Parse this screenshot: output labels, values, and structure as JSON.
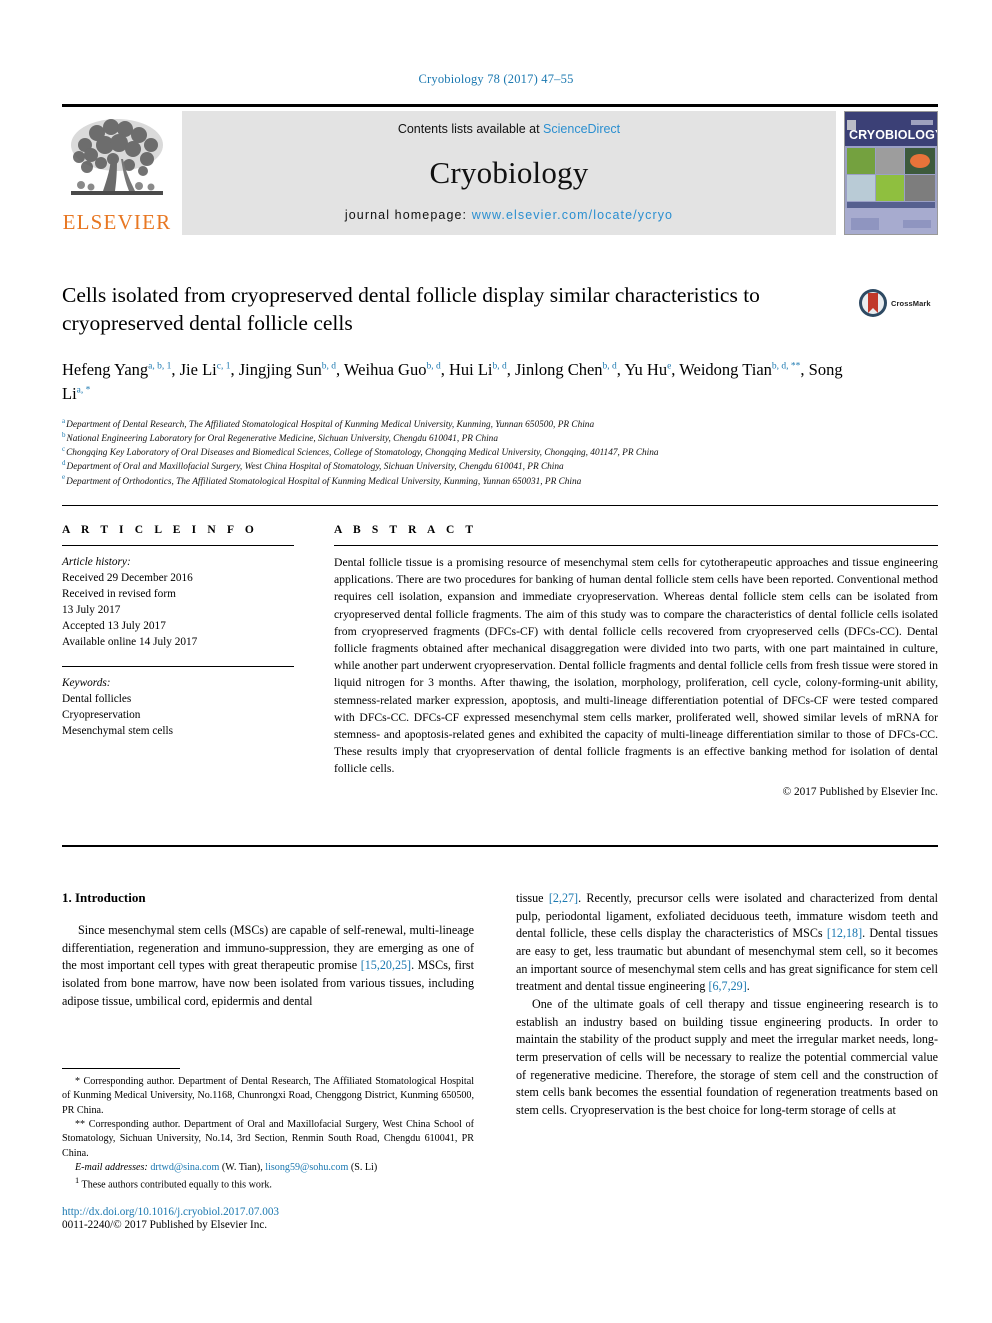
{
  "running_head": "Cryobiology 78 (2017) 47–55",
  "masthead": {
    "contents_prefix": "Contents lists available at ",
    "contents_link": "ScienceDirect",
    "journal_name": "Cryobiology",
    "homepage_prefix": "journal homepage: ",
    "homepage_url": "www.elsevier.com/locate/ycryo",
    "publisher": "ELSEVIER",
    "cover_title": "CRYOBIOLOGY",
    "tree_icon": "elsevier-tree-icon"
  },
  "title": "Cells isolated from cryopreserved dental follicle display similar characteristics to cryopreserved dental follicle cells",
  "crossmark": {
    "label": "CrossMark"
  },
  "authors": [
    {
      "name": "Hefeng Yang",
      "marks": "a, b, 1"
    },
    {
      "name": "Jie Li",
      "marks": "c, 1"
    },
    {
      "name": "Jingjing Sun",
      "marks": "b, d"
    },
    {
      "name": "Weihua Guo",
      "marks": "b, d"
    },
    {
      "name": "Hui Li",
      "marks": "b, d"
    },
    {
      "name": "Jinlong Chen",
      "marks": "b, d"
    },
    {
      "name": "Yu Hu",
      "marks": "e"
    },
    {
      "name": "Weidong Tian",
      "marks": "b, d, **"
    },
    {
      "name": "Song Li",
      "marks": "a, *"
    }
  ],
  "affiliations": [
    {
      "mark": "a",
      "text": "Department of Dental Research, The Affiliated Stomatological Hospital of Kunming Medical University, Kunming, Yunnan 650500, PR China"
    },
    {
      "mark": "b",
      "text": "National Engineering Laboratory for Oral Regenerative Medicine, Sichuan University, Chengdu 610041, PR China"
    },
    {
      "mark": "c",
      "text": "Chongqing Key Laboratory of Oral Diseases and Biomedical Sciences, College of Stomatology, Chongqing Medical University, Chongqing, 401147, PR China"
    },
    {
      "mark": "d",
      "text": "Department of Oral and Maxillofacial Surgery, West China Hospital of Stomatology, Sichuan University, Chengdu 610041, PR China"
    },
    {
      "mark": "e",
      "text": "Department of Orthodontics, The Affiliated Stomatological Hospital of Kunming Medical University, Kunming, Yunnan 650031, PR China"
    }
  ],
  "article_info": {
    "heading": "A R T I C L E  I N F O",
    "history_label": "Article history:",
    "history": [
      "Received 29 December 2016",
      "Received in revised form",
      "13 July 2017",
      "Accepted 13 July 2017",
      "Available online 14 July 2017"
    ],
    "keywords_label": "Keywords:",
    "keywords": [
      "Dental follicles",
      "Cryopreservation",
      "Mesenchymal stem cells"
    ]
  },
  "abstract": {
    "heading": "A B S T R A C T",
    "text": "Dental follicle tissue is a promising resource of mesenchymal stem cells for cytotherapeutic approaches and tissue engineering applications. There are two procedures for banking of human dental follicle stem cells have been reported. Conventional method requires cell isolation, expansion and immediate cryopreservation. Whereas dental follicle stem cells can be isolated from cryopreserved dental follicle fragments. The aim of this study was to compare the characteristics of dental follicle cells isolated from cryopreserved fragments (DFCs-CF) with dental follicle cells recovered from cryopreserved cells (DFCs-CC). Dental follicle fragments obtained after mechanical disaggregation were divided into two parts, with one part maintained in culture, while another part underwent cryopreservation. Dental follicle fragments and dental follicle cells from fresh tissue were stored in liquid nitrogen for 3 months. After thawing, the isolation, morphology, proliferation, cell cycle, colony-forming-unit ability, stemness-related marker expression, apoptosis, and multi-lineage differentiation potential of DFCs-CF were tested compared with DFCs-CC. DFCs-CF expressed mesenchymal stem cells marker, proliferated well, showed similar levels of mRNA for stemness- and apoptosis-related genes and exhibited the capacity of multi-lineage differentiation similar to those of DFCs-CC. These results imply that cryopreservation of dental follicle fragments is an effective banking method for isolation of dental follicle cells.",
    "copyright": "© 2017 Published by Elsevier Inc."
  },
  "introduction": {
    "heading": "1. Introduction",
    "left_paragraphs": [
      "Since mesenchymal stem cells (MSCs) are capable of self-renewal, multi-lineage differentiation, regeneration and immuno-suppression, they are emerging as one of the most important cell types with great therapeutic promise [15,20,25]. MSCs, first isolated from bone marrow, have now been isolated from various tissues, including adipose tissue, umbilical cord, epidermis and dental"
    ],
    "right_paragraphs": [
      "tissue [2,27]. Recently, precursor cells were isolated and characterized from dental pulp, periodontal ligament, exfoliated deciduous teeth, immature wisdom teeth and dental follicle, these cells display the characteristics of MSCs [12,18]. Dental tissues are easy to get, less traumatic but abundant of mesenchymal stem cell, so it becomes an important source of mesenchymal stem cells and has great significance for stem cell treatment and dental tissue engineering [6,7,29].",
      "One of the ultimate goals of cell therapy and tissue engineering research is to establish an industry based on building tissue engineering products. In order to maintain the stability of the product supply and meet the irregular market needs, long-term preservation of cells will be necessary to realize the potential commercial value of regenerative medicine. Therefore, the storage of stem cell and the construction of stem cells bank becomes the essential foundation of regeneration treatments based on stem cells. Cryopreservation is the best choice for long-term storage of cells at"
    ]
  },
  "footnotes": {
    "corresponding_1": "Corresponding author. Department of Dental Research, The Affiliated Stomatological Hospital of Kunming Medical University, No.1168, Chunrongxi Road, Chenggong District, Kunming 650500, PR China.",
    "corresponding_1_symbol": "*",
    "corresponding_2": "Corresponding author. Department of Oral and Maxillofacial Surgery, West China School of Stomatology, Sichuan University, No.14, 3rd Section, Renmin South Road, Chengdu 610041, PR China.",
    "corresponding_2_symbol": "**",
    "email_label": "E-mail addresses:",
    "email_1": "drtwd@sina.com",
    "email_1_owner": "(W. Tian)",
    "email_2": "lisong59@sohu.com",
    "email_2_owner": "(S. Li)",
    "equal_contribution_symbol": "1",
    "equal_contribution": "These authors contributed equally to this work."
  },
  "footer": {
    "doi": "http://dx.doi.org/10.1016/j.cryobiol.2017.07.003",
    "issn": "0011-2240/© 2017 Published by Elsevier Inc."
  },
  "colors": {
    "link": "#1b78b0",
    "elsevier_orange": "#E87722",
    "masthead_grey": "#e3e3e3"
  }
}
